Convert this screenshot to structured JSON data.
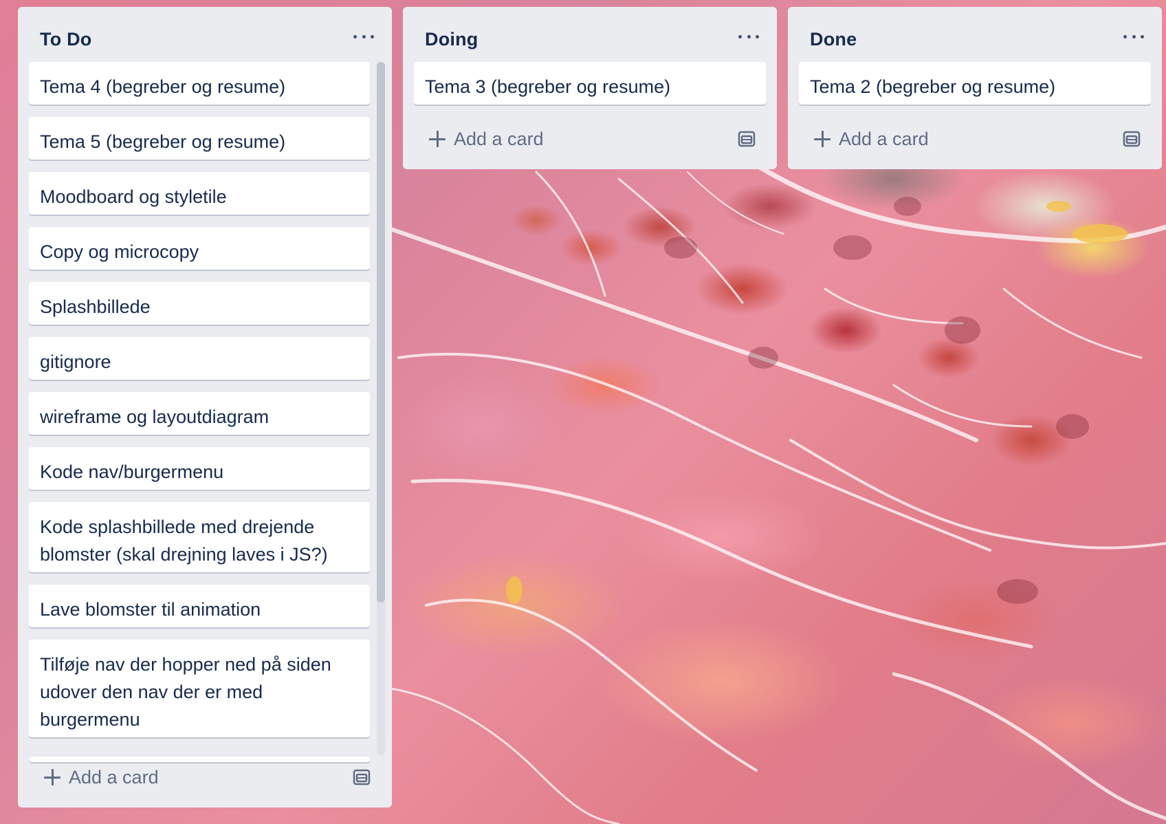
{
  "lists": [
    {
      "title": "To Do",
      "cards": [
        "Tema 4 (begreber og resume)",
        "Tema 5 (begreber og resume)",
        "Moodboard og styletile",
        "Copy og microcopy",
        "Splashbillede",
        "gitignore",
        "wireframe og layoutdiagram",
        "Kode nav/burgermenu",
        "Kode splashbillede med drejende blomster (skal drejning laves i JS?)",
        "Lave blomster til animation",
        "Tilføje nav der hopper ned på siden udover den nav der er med burgermenu"
      ],
      "add_card_label": "Add a card"
    },
    {
      "title": "Doing",
      "cards": [
        "Tema 3 (begreber og resume)"
      ],
      "add_card_label": "Add a card"
    },
    {
      "title": "Done",
      "cards": [
        "Tema 2 (begreber og resume)"
      ],
      "add_card_label": "Add a card"
    }
  ],
  "icons": {
    "list_menu": "more-horizontal-icon",
    "add_card": "plus-icon",
    "template": "card-template-icon"
  },
  "colors": {
    "list_background": "#ebecf0",
    "card_background": "#ffffff",
    "text_primary": "#172b4d",
    "text_secondary": "#5e6c84"
  }
}
